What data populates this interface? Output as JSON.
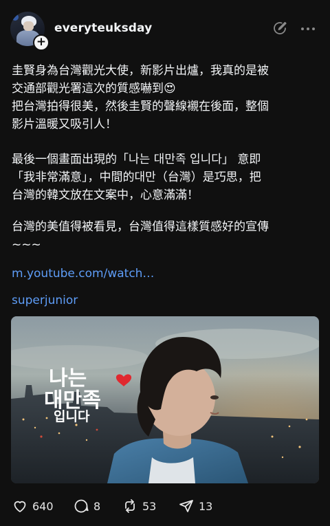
{
  "header": {
    "username": "everyteuksday",
    "follow_badge": "+",
    "avatar_icon": "user-avatar",
    "edit_icon": "pencil-circle-icon",
    "more_icon": "ellipsis-icon"
  },
  "post": {
    "paragraph_1": "圭賢身為台灣觀光大使，新影片出爐，我真的是被\n交通部觀光署這次的質感嚇到😍\n把台灣拍得很美，然後圭賢的聲線襯在後面，整個\n影片溫暖又吸引人！",
    "paragraph_2": "最後一個畫面出現的「나는 대만족 입니다」 意即\n「我非常滿意」，中間的대만（台灣）是巧思，把\n台灣的韓文放在文案中，心意滿滿！",
    "paragraph_3": "台灣的美值得被看見，台灣值得這樣質感好的宣傳\n~~~",
    "youtube_link": "m.youtube.com/watch…",
    "tag_link": "superjunior"
  },
  "media": {
    "overlay_line_1": "나는",
    "overlay_line_2": "대만족",
    "overlay_line_3": "입니다",
    "heart_color": "#e0282f"
  },
  "actions": {
    "likes": "640",
    "replies": "8",
    "reposts": "53",
    "shares": "13"
  },
  "colors": {
    "background": "#101010",
    "text": "#f3f5f7",
    "link": "#5e9df7"
  }
}
